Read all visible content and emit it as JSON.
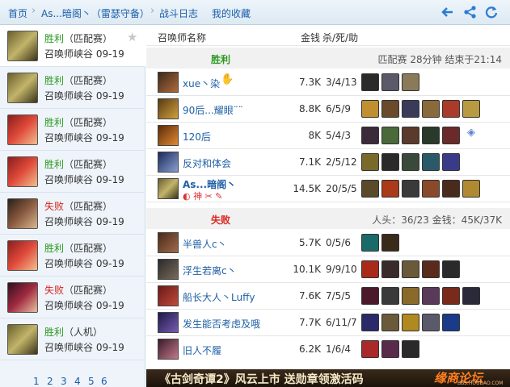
{
  "nav": {
    "crumbs": [
      "首页",
      "As...暗阁丶（雷瑟守备）",
      "战斗日志",
      "我的收藏"
    ],
    "icons": [
      "back-arrow-icon",
      "share-icon",
      "refresh-icon"
    ]
  },
  "sidebar": {
    "matches": [
      {
        "result": "胜利",
        "mode": "（匹配赛）",
        "map": "召唤师峡谷",
        "date": "09-19",
        "win": true
      },
      {
        "result": "胜利",
        "mode": "（匹配赛）",
        "map": "召唤师峡谷",
        "date": "09-19",
        "win": true
      },
      {
        "result": "胜利",
        "mode": "（匹配赛）",
        "map": "召唤师峡谷",
        "date": "09-19",
        "win": true
      },
      {
        "result": "胜利",
        "mode": "（匹配赛）",
        "map": "召唤师峡谷",
        "date": "09-19",
        "win": true
      },
      {
        "result": "失败",
        "mode": "（匹配赛）",
        "map": "召唤师峡谷",
        "date": "09-19",
        "win": false
      },
      {
        "result": "胜利",
        "mode": "（匹配赛）",
        "map": "召唤师峡谷",
        "date": "09-19",
        "win": true
      },
      {
        "result": "失败",
        "mode": "（匹配赛）",
        "map": "召唤师峡谷",
        "date": "09-19",
        "win": false
      },
      {
        "result": "胜利",
        "mode": "（人机）",
        "map": "召唤师峡谷",
        "date": "09-19",
        "win": true
      }
    ],
    "pages": [
      "1",
      "2",
      "3",
      "4",
      "5",
      "6"
    ]
  },
  "table": {
    "headers": {
      "name": "召唤师名称",
      "gold": "金钱",
      "kda": "杀/死/助"
    }
  },
  "winTeam": {
    "label": "胜利",
    "info": "匹配赛 28分钟 结束于21:14",
    "players": [
      {
        "name": "xue丶染",
        "gold": "7.3K",
        "kda": "3/4/13",
        "extra": "✋"
      },
      {
        "name": "90后...耀眼¨¨",
        "gold": "8.8K",
        "kda": "6/5/9"
      },
      {
        "name": "120后",
        "gold": "8K",
        "kda": "5/4/3",
        "extra": "◈"
      },
      {
        "name": "反对和体会",
        "gold": "7.1K",
        "kda": "2/5/12"
      },
      {
        "name": "As...暗阁丶",
        "gold": "14.5K",
        "kda": "20/5/5",
        "tags": "◐ 神 ✂ ✎"
      }
    ]
  },
  "loseTeam": {
    "label": "失败",
    "info": "人头：36/23 金钱：45K/37K",
    "players": [
      {
        "name": "半兽人c丶",
        "gold": "5.7K",
        "kda": "0/5/6"
      },
      {
        "name": "浮生若离c丶",
        "gold": "10.1K",
        "kda": "9/9/10"
      },
      {
        "name": "船长大人丶Luffy",
        "gold": "7.6K",
        "kda": "7/5/5"
      },
      {
        "name": "发生能否考虑及哦",
        "gold": "7.7K",
        "kda": "6/11/7"
      },
      {
        "name": "旧人不履",
        "gold": "6.2K",
        "kda": "1/6/4"
      }
    ]
  },
  "banner": {
    "text": "《古剑奇谭2》风云上市  送勋章领激活码",
    "watermark": "缘商论坛",
    "watermark_sub": "BBS.HOUDAO.COM"
  },
  "colors": {
    "win": "#2a9a1f",
    "lose": "#d8261d",
    "link": "#1a5ea8"
  }
}
